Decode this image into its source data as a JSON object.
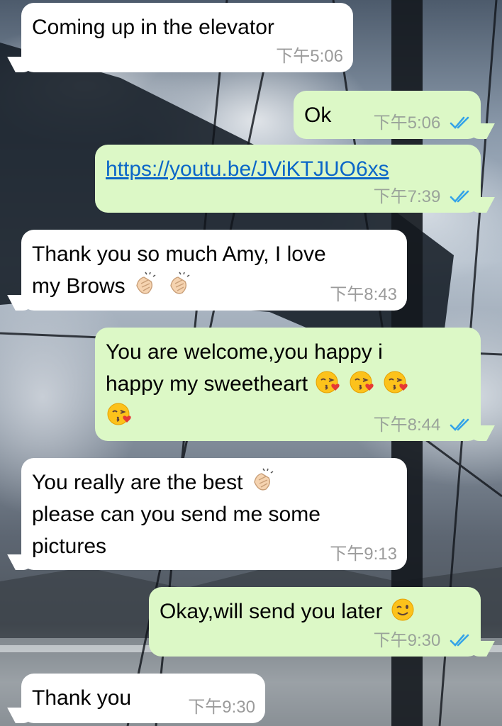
{
  "colors": {
    "incoming_bubble": "#ffffff",
    "outgoing_bubble": "#dcf8c6",
    "link": "#0a66c8",
    "read_tick": "#34a3e8",
    "timestamp": "#9b9b9b"
  },
  "messages": [
    {
      "direction": "in",
      "text": "Coming up in the elevator",
      "time": "下午5:06"
    },
    {
      "direction": "out",
      "text": "Ok",
      "time": "下午5:06",
      "status": "read-double-tick-icon"
    },
    {
      "direction": "out",
      "text": "https://youtu.be/JViKTJUO6xs",
      "time": "下午7:39",
      "status": "read-double-tick-icon",
      "is_link": true
    },
    {
      "direction": "in",
      "text_line1": "Thank you so much Amy, I love",
      "text_line2": "my Brows",
      "emojis": [
        "clapping-hands-emoji",
        "clapping-hands-emoji"
      ],
      "time": "下午8:43"
    },
    {
      "direction": "out",
      "text_line1": "You are welcome,you happy i",
      "text_line2": "happy my sweetheart",
      "emojis": [
        "face-blowing-kiss-emoji",
        "face-blowing-kiss-emoji",
        "face-blowing-kiss-emoji",
        "face-blowing-kiss-emoji"
      ],
      "time": "下午8:44",
      "status": "read-double-tick-icon"
    },
    {
      "direction": "in",
      "text_line1": "You really are the best",
      "text_line2": "please can you send me some",
      "text_line3": "pictures",
      "emojis": [
        "clapping-hands-emoji"
      ],
      "time": "下午9:13"
    },
    {
      "direction": "out",
      "text": "Okay,will send you later",
      "emojis": [
        "winking-face-emoji"
      ],
      "time": "下午9:30",
      "status": "read-double-tick-icon"
    },
    {
      "direction": "in",
      "text": "Thank you",
      "time": "下午9:30"
    }
  ]
}
